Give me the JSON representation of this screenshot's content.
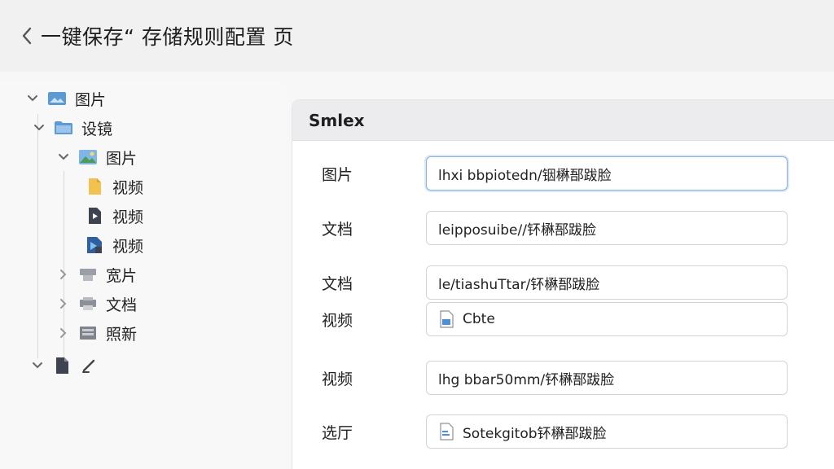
{
  "header": {
    "title": "一键保存“ 存储规则配置 页"
  },
  "tree": {
    "items": [
      {
        "label": "图片",
        "icon": "image-folder-icon"
      },
      {
        "label": "设镜",
        "icon": "folder-icon"
      },
      {
        "label": "图片",
        "icon": "image-icon"
      },
      {
        "label": "视频",
        "icon": "document-icon"
      },
      {
        "label": "视频",
        "icon": "video-file-icon"
      },
      {
        "label": "视频",
        "icon": "media-file-icon"
      },
      {
        "label": "宽片",
        "icon": "drive-icon"
      },
      {
        "label": "文档",
        "icon": "printer-icon"
      },
      {
        "label": "照新",
        "icon": "archive-icon"
      },
      {
        "label": "",
        "icon": "file-edit-icon"
      }
    ]
  },
  "panel": {
    "title": "Smlex",
    "rows": [
      {
        "label": "图片",
        "value": "lhxi bbpiotedn/铟楙郚跋脸"
      },
      {
        "label": "文档",
        "value": "leipposuibe//钚楙郚跋脸"
      },
      {
        "label": "文档",
        "value": "le/tiashuTtar/钚楙郚跋脸"
      },
      {
        "label": "视频",
        "value": "Cbte"
      },
      {
        "label": "视频",
        "value": "lhg bbar50mm/钚楙郚跋脸"
      },
      {
        "label": "选厅",
        "value": "Sotekgitob钚楙郚跋脸"
      }
    ]
  },
  "colors": {
    "accent": "#4a90d9",
    "folder": "#5b9bd5",
    "doc_yellow": "#f2c14e"
  }
}
